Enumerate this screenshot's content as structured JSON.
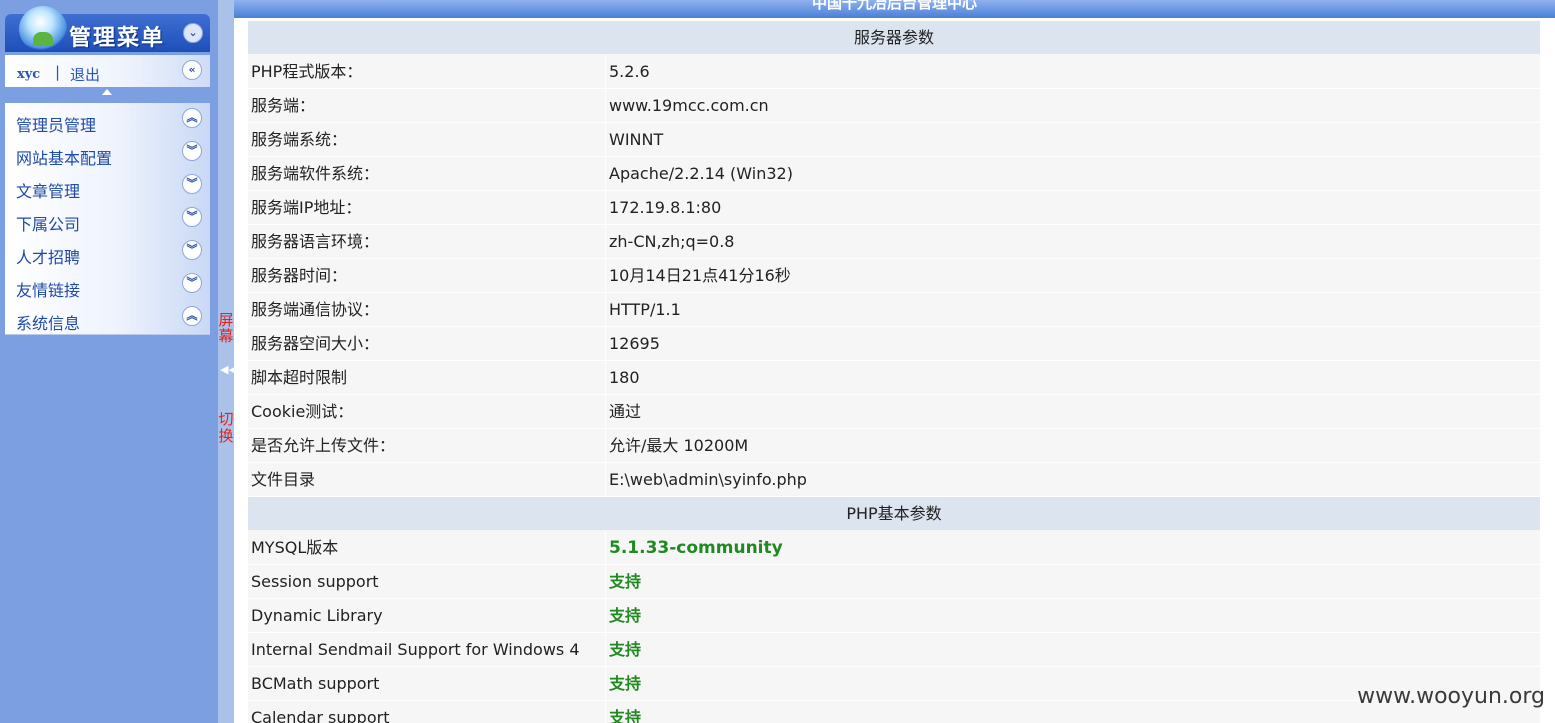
{
  "header": {
    "title": "中国十九冶后台管理中心"
  },
  "menu": {
    "title": "管理菜单",
    "user": "xyc",
    "separator": "|",
    "logout": "退出",
    "items": [
      {
        "label": "管理员管理",
        "state": "expanded"
      },
      {
        "label": "网站基本配置",
        "state": "collapsed"
      },
      {
        "label": "文章管理",
        "state": "collapsed"
      },
      {
        "label": "下属公司",
        "state": "collapsed"
      },
      {
        "label": "人才招聘",
        "state": "collapsed"
      },
      {
        "label": "友情链接",
        "state": "collapsed"
      },
      {
        "label": "系统信息",
        "state": "expanded"
      }
    ]
  },
  "toggle": {
    "chars_top": [
      "屏",
      "幕"
    ],
    "chars_bottom": [
      "切",
      "换"
    ]
  },
  "server": {
    "heading": "服务器参数",
    "rows": [
      {
        "k": "PHP程式版本：",
        "v": "5.2.6"
      },
      {
        "k": "服务端：",
        "v": "www.19mcc.com.cn"
      },
      {
        "k": "服务端系统：",
        "v": "WINNT"
      },
      {
        "k": "服务端软件系统：",
        "v": "Apache/2.2.14 (Win32)"
      },
      {
        "k": "服务端IP地址：",
        "v": "172.19.8.1:80"
      },
      {
        "k": "服务器语言环境：",
        "v": "zh-CN,zh;q=0.8"
      },
      {
        "k": "服务器时间：",
        "v": "10月14日21点41分16秒"
      },
      {
        "k": "服务端通信协议：",
        "v": "HTTP/1.1"
      },
      {
        "k": "服务器空间大小：",
        "v": "12695"
      },
      {
        "k": "脚本超时限制",
        "v": "180"
      },
      {
        "k": "Cookie测试：",
        "v": "通过"
      },
      {
        "k": "是否允许上传文件：",
        "v": "允许/最大 10200M"
      },
      {
        "k": "文件目录",
        "v": "E:\\web\\admin\\syinfo.php"
      }
    ]
  },
  "php": {
    "heading": "PHP基本参数",
    "rows": [
      {
        "k": "MYSQL版本",
        "v": "5.1.33-community"
      },
      {
        "k": "Session support",
        "v": "支持"
      },
      {
        "k": "Dynamic Library",
        "v": "支持"
      },
      {
        "k": "Internal Sendmail Support for Windows 4",
        "v": "支持"
      },
      {
        "k": "BCMath support",
        "v": "支持"
      },
      {
        "k": "Calendar support",
        "v": "支持"
      }
    ]
  },
  "watermark": "www.wooyun.org",
  "colors": {
    "menu_bg": "#7b9fe0",
    "ok_green": "#1f8a1f",
    "toggle_red": "#e0241c"
  }
}
